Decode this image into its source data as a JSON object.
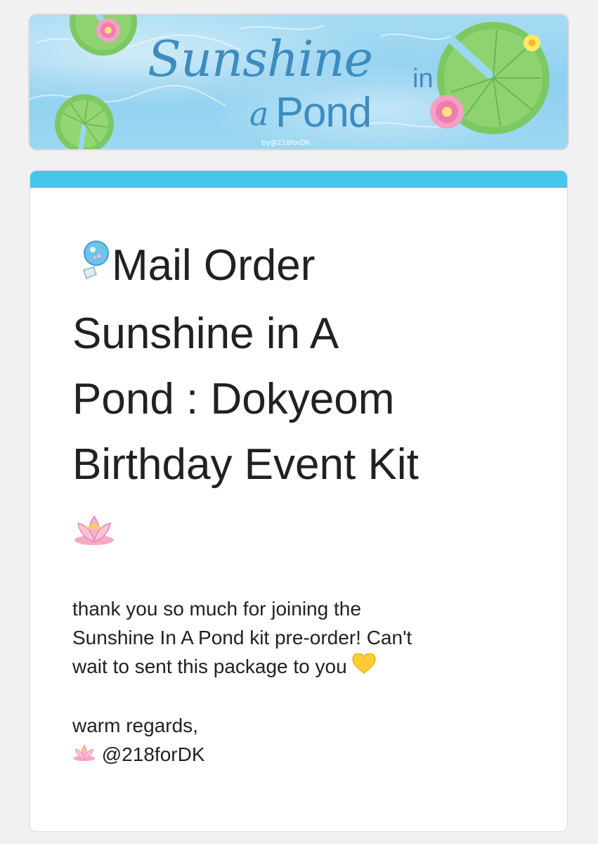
{
  "banner": {
    "title_script": "Sunshine",
    "title_in": "in",
    "title_a": "a",
    "title_pond": "Pond",
    "byline": "by@218forDK",
    "colors": {
      "water": "#9ad7f2",
      "lily_pad": "#7cc862",
      "lotus": "#f07cb0",
      "title": "#3d8cbf"
    }
  },
  "form": {
    "accent_color": "#47c4ea",
    "title_lines": [
      "Mail Order",
      "Sunshine in A",
      "Pond : Dokyeom",
      "Birthday Event Kit"
    ],
    "title_leading_icon": "wind-chime-icon",
    "title_trailing_icon": "lotus-icon",
    "description_lines": [
      "thank you so much for joining the",
      "Sunshine In A Pond kit pre-order! Can't",
      "wait to sent this package to you",
      "",
      "warm regards,",
      "@218forDK"
    ],
    "description_icons": [
      "yellow-heart-icon",
      "lotus-icon"
    ]
  }
}
